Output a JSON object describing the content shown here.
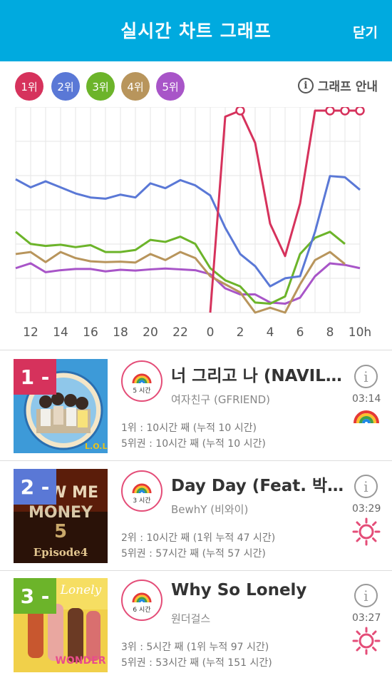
{
  "header": {
    "title": "실시간 차트 그래프",
    "close_label": "닫기"
  },
  "legend": [
    {
      "label": "1위",
      "color": "#d6325c"
    },
    {
      "label": "2위",
      "color": "#5a78d6"
    },
    {
      "label": "3위",
      "color": "#6cb42a"
    },
    {
      "label": "4위",
      "color": "#b8955c"
    },
    {
      "label": "5위",
      "color": "#a855c8"
    }
  ],
  "guide_label": "그래프 안내",
  "chart_data": {
    "type": "line",
    "x": [
      "11",
      "12",
      "13",
      "14",
      "15",
      "16",
      "17",
      "18",
      "19",
      "20",
      "21",
      "22",
      "23",
      "0",
      "1",
      "2",
      "3",
      "4",
      "5",
      "6",
      "7",
      "8",
      "9",
      "10"
    ],
    "xtick_labels": [
      "12",
      "14",
      "16",
      "18",
      "20",
      "22",
      "0",
      "2",
      "4",
      "6",
      "8",
      "10h"
    ],
    "y_axis": "rank (1 = top, lower ranks lower on the chart), no printed scale",
    "series": [
      {
        "name": "1위",
        "color": "#d6325c",
        "values": [
          null,
          null,
          null,
          null,
          null,
          null,
          null,
          null,
          null,
          null,
          null,
          null,
          null,
          6,
          1.15,
          1,
          1.8,
          3.8,
          4.6,
          3.3,
          1,
          1,
          1,
          1
        ],
        "markers": [
          15,
          21,
          22,
          23
        ]
      },
      {
        "name": "2위",
        "color": "#5a78d6",
        "values": [
          2.7,
          2.9,
          2.75,
          2.9,
          3.05,
          3.15,
          3.18,
          3.08,
          3.15,
          2.8,
          2.92,
          2.72,
          2.85,
          3.1,
          3.9,
          4.55,
          4.85,
          5.35,
          5.15,
          5.1,
          4.0,
          2.62,
          2.65,
          2.96
        ]
      },
      {
        "name": "3위",
        "color": "#6cb42a",
        "values": [
          4.0,
          4.3,
          4.35,
          4.32,
          4.38,
          4.33,
          4.5,
          4.5,
          4.45,
          4.2,
          4.25,
          4.12,
          4.3,
          4.9,
          5.2,
          5.35,
          5.75,
          5.78,
          5.6,
          4.55,
          4.15,
          4.0,
          4.3,
          null
        ]
      },
      {
        "name": "4위",
        "color": "#b8955c",
        "values": [
          4.55,
          4.5,
          4.75,
          4.5,
          4.65,
          4.73,
          4.75,
          4.74,
          4.76,
          4.55,
          4.7,
          4.5,
          4.65,
          5.1,
          5.3,
          5.5,
          6.0,
          5.88,
          6.0,
          5.3,
          4.7,
          4.5,
          4.8,
          null
        ]
      },
      {
        "name": "5위",
        "color": "#a855c8",
        "values": [
          4.9,
          4.78,
          5.0,
          4.95,
          4.92,
          4.92,
          4.98,
          4.94,
          4.96,
          4.93,
          4.91,
          4.93,
          4.95,
          5.05,
          5.4,
          5.55,
          5.55,
          5.75,
          5.78,
          5.63,
          5.1,
          4.78,
          4.82,
          4.9
        ]
      }
    ]
  },
  "songs": [
    {
      "rank": "1 -",
      "rank_color": "#d6325c",
      "hours": "5 시간",
      "title": "너 그리고 나 (NAVILLERA)",
      "artist": "여자친구 (GFRIEND)",
      "stat1": "1위 : 10시간 째 (누적 10 시간)",
      "stat2": "5위권 : 10시간 째 (누적 10 시간)",
      "time": "03:14",
      "weather_icon": "rainbow-icon",
      "info_label": "i"
    },
    {
      "rank": "2 -",
      "rank_color": "#5a78d6",
      "hours": "3 시간",
      "title": "Day Day (Feat. 박재범)",
      "artist": "BewhY (비와이)",
      "stat1": "2위 : 10시간 째 (1위 누적 47 시간)",
      "stat2": "5위권 : 57시간 째 (누적 57 시간)",
      "time": "03:29",
      "weather_icon": "sun-icon",
      "info_label": "i"
    },
    {
      "rank": "3 -",
      "rank_color": "#6cb42a",
      "hours": "6 시간",
      "title": "Why So Lonely",
      "artist": "원더걸스",
      "stat1": "3위 : 5시간 째 (1위 누적 97 시간)",
      "stat2": "5위권 : 53시간 째 (누적 151 시간)",
      "time": "03:27",
      "weather_icon": "sun-icon",
      "info_label": "i"
    }
  ]
}
